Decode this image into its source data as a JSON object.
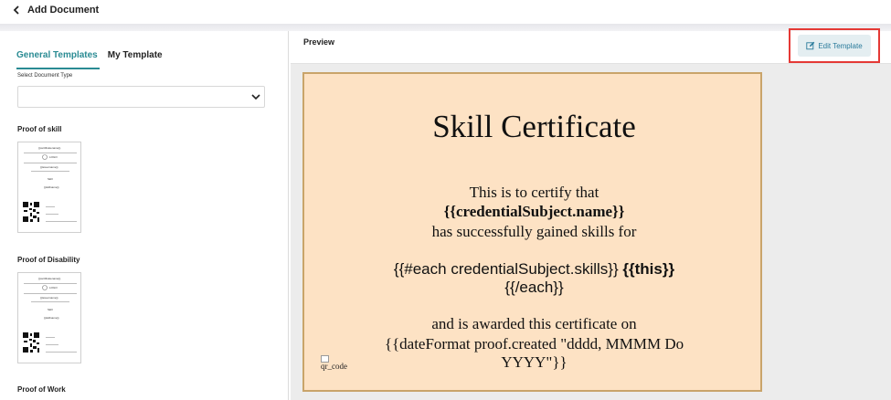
{
  "header": {
    "back_label": "Add Document",
    "back_icon": "chevron-left-icon"
  },
  "left_panel": {
    "tabs": [
      {
        "label": "General Templates",
        "active": true
      },
      {
        "label": "My Template",
        "active": false
      }
    ],
    "select_label": "Select Document Type",
    "select_value": "",
    "templates": [
      {
        "title": "Proof of skill",
        "thumb": {
          "heading": "{{certificatename}}",
          "logo": "LOGO",
          "name": "{{issuername}}",
          "line1": "Skill",
          "line2": "{{skillname}}"
        }
      },
      {
        "title": "Proof of Disability",
        "thumb": {
          "heading": "{{certificatename}}",
          "logo": "LOGO",
          "name": "{{issuername}}",
          "line1": "Skill",
          "line2": "{{skillname}}"
        }
      },
      {
        "title": "Proof of Work"
      }
    ]
  },
  "preview": {
    "title": "Preview",
    "edit_button_label": "Edit Template",
    "edit_icon": "edit-icon",
    "certificate": {
      "title": "Skill Certificate",
      "line1": "This is to certify that",
      "line2": "{{credentialSubject.name}}",
      "line3": "has successfully gained skills for",
      "line4a": "{{#each credentialSubject.skills}}",
      "line4b": "{{this}}",
      "line5": "{{/each}}",
      "line6": "and is awarded this certificate on",
      "line7": "{{dateFormat proof.created \"dddd, MMMM Do",
      "line8": "YYYY\"}}",
      "qr_alt": "qr_code"
    }
  },
  "colors": {
    "accent": "#2a8b93",
    "certificate_bg": "#fde2c4",
    "highlight": "#e53935"
  }
}
